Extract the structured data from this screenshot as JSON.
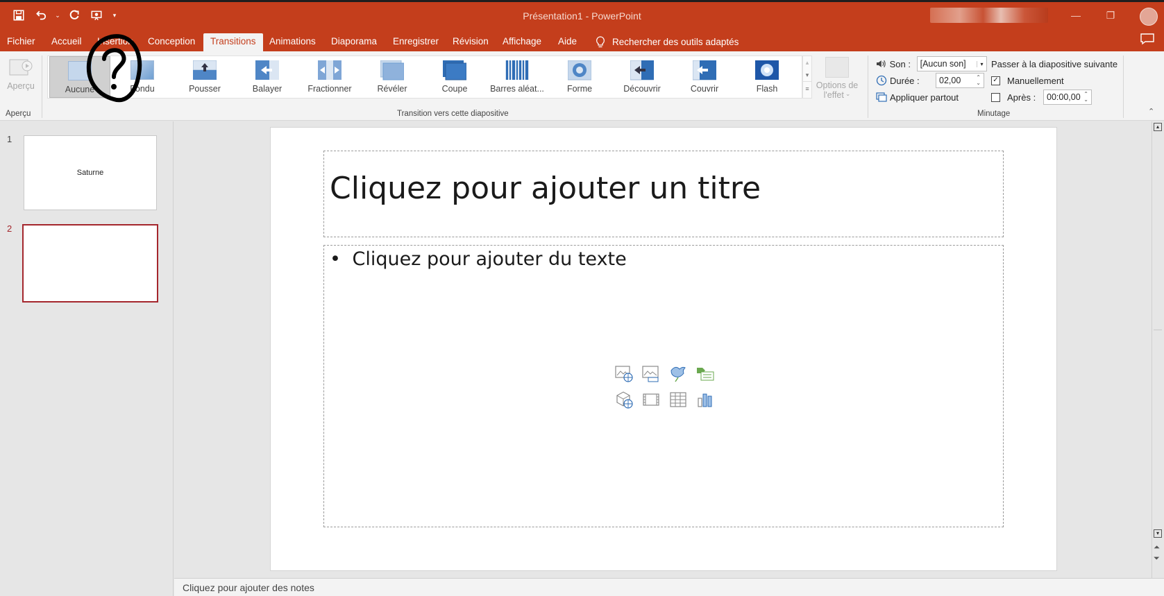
{
  "window": {
    "title": "Présentation1  -  PowerPoint"
  },
  "qat": {
    "icons": [
      "save-icon",
      "undo-icon",
      "redo-icon",
      "present-from-start-icon",
      "customize-qat-icon"
    ]
  },
  "tabs": [
    {
      "label": "Fichier"
    },
    {
      "label": "Accueil"
    },
    {
      "label": "Insertion"
    },
    {
      "label": "Conception"
    },
    {
      "label": "Transitions",
      "active": true
    },
    {
      "label": "Animations"
    },
    {
      "label": "Diaporama"
    },
    {
      "label": "Enregistrer"
    },
    {
      "label": "Révision"
    },
    {
      "label": "Affichage"
    },
    {
      "label": "Aide"
    }
  ],
  "tellme": {
    "label": "Rechercher des outils adaptés"
  },
  "ribbon": {
    "apercu": {
      "button": "Aperçu",
      "group_label": "Aperçu"
    },
    "transitions": {
      "group_label": "Transition vers cette diapositive",
      "items": [
        {
          "label": "Aucune",
          "selected": true
        },
        {
          "label": "Fondu"
        },
        {
          "label": "Pousser"
        },
        {
          "label": "Balayer"
        },
        {
          "label": "Fractionner"
        },
        {
          "label": "Révéler"
        },
        {
          "label": "Coupe"
        },
        {
          "label": "Barres aléat..."
        },
        {
          "label": "Forme"
        },
        {
          "label": "Découvrir"
        },
        {
          "label": "Couvrir"
        },
        {
          "label": "Flash"
        }
      ],
      "options_line1": "Options de",
      "options_line2": "l'effet"
    },
    "timing": {
      "group_label": "Minutage",
      "son_label": "Son :",
      "son_value": "[Aucun son]",
      "duree_label": "Durée :",
      "duree_value": "02,00",
      "apply_all": "Appliquer partout",
      "advance_label": "Passer à la diapositive suivante",
      "manual_label": "Manuellement",
      "manual_checked": true,
      "after_label": "Après :",
      "after_checked": false,
      "after_value": "00:00,00"
    }
  },
  "slides": [
    {
      "number": "1",
      "text": "Saturne"
    },
    {
      "number": "2",
      "text": "",
      "selected": true
    }
  ],
  "slide": {
    "title_placeholder": "Cliquez pour ajouter un titre",
    "body_placeholder": "Cliquez pour ajouter du texte",
    "bullet": "•"
  },
  "notes": {
    "placeholder": "Cliquez pour ajouter des notes"
  },
  "colors": {
    "accent": "#c43e1c",
    "selected_thumb_border": "#a4262c"
  }
}
